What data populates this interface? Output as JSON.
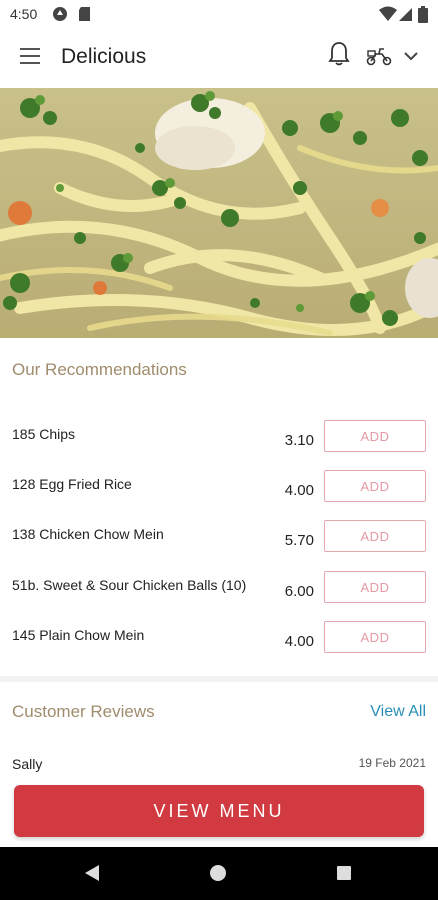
{
  "status_bar": {
    "time": "4:50",
    "icons": [
      "circle-app-icon",
      "sd-card-icon",
      "wifi-icon",
      "signal-icon",
      "battery-icon"
    ]
  },
  "app_bar": {
    "title": "Delicious",
    "icons": [
      "menu-icon",
      "bell-icon",
      "delivery-icon",
      "chevron-down-icon"
    ]
  },
  "hero": {
    "image": "soup-photo"
  },
  "recommendations": {
    "title": "Our Recommendations",
    "add_label": "ADD",
    "items": [
      {
        "name": "185 Chips",
        "price": "3.10"
      },
      {
        "name": "128 Egg Fried Rice",
        "price": "4.00"
      },
      {
        "name": "138 Chicken Chow Mein",
        "price": "5.70"
      },
      {
        "name": "51b. Sweet & Sour Chicken Balls (10)",
        "price": "6.00"
      },
      {
        "name": "145 Plain Chow Mein",
        "price": "4.00"
      }
    ]
  },
  "reviews": {
    "title": "Customer Reviews",
    "view_all": "View All",
    "items": [
      {
        "reviewer": "Sally",
        "date": "19 Feb 2021"
      }
    ]
  },
  "cta": {
    "label": "VIEW MENU"
  },
  "colors": {
    "accent": "#d03a40",
    "section_title": "#a08c6c",
    "link": "#2a8fb8",
    "add_border": "#e6a9b0"
  }
}
